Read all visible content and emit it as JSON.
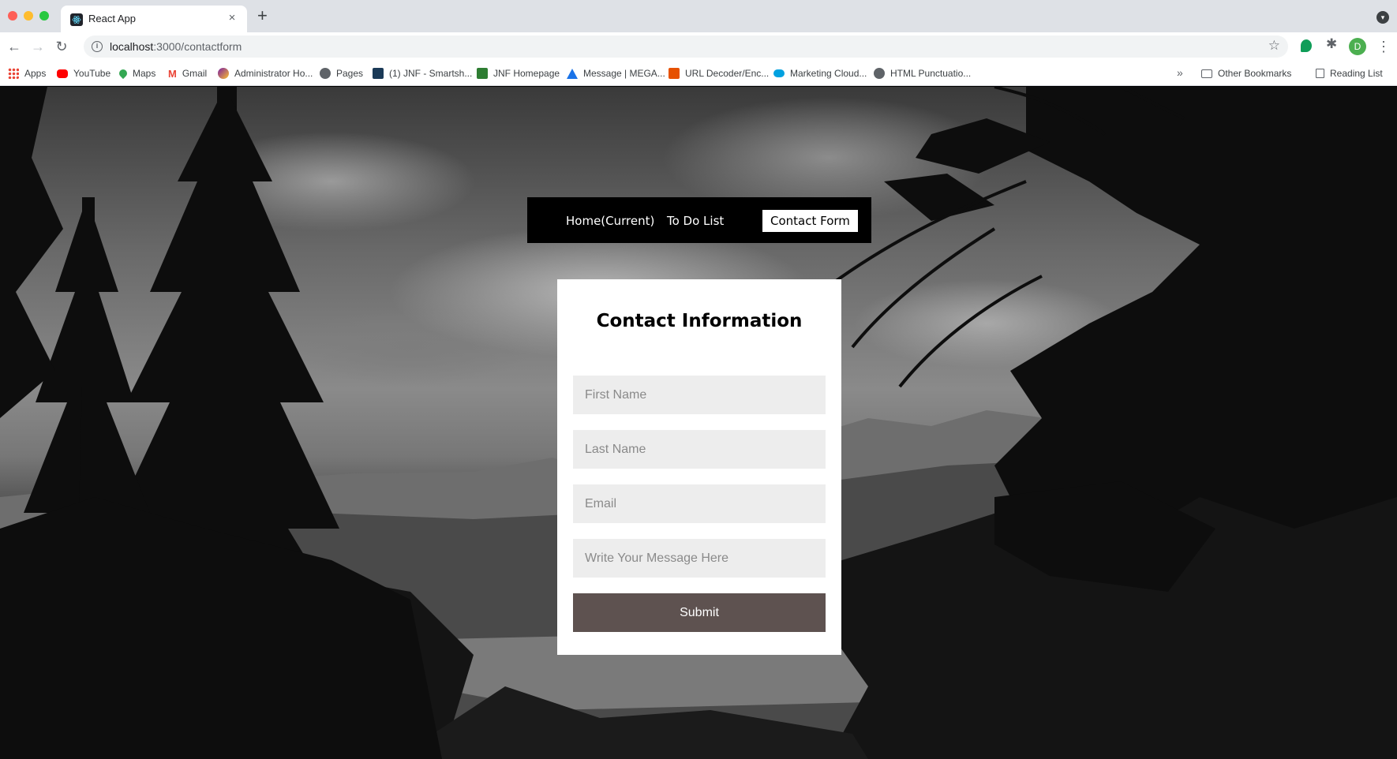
{
  "browser": {
    "tab_title": "React App",
    "tab_close": "×",
    "new_tab": "+",
    "url_host": "localhost",
    "url_path": ":3000/contactform",
    "profile_initial": "D",
    "bookmarks": [
      {
        "label": "Apps",
        "icon": "apps-grid-icon",
        "color": "#ea4335"
      },
      {
        "label": "YouTube",
        "icon": "youtube-icon",
        "color": "#ff0000"
      },
      {
        "label": "Maps",
        "icon": "maps-pin-icon",
        "color": "#34a853"
      },
      {
        "label": "Gmail",
        "icon": "gmail-icon",
        "color": "#ea4335"
      },
      {
        "label": "Administrator Ho...",
        "icon": "admin-icon",
        "color": "#7b1fa2"
      },
      {
        "label": "Pages",
        "icon": "globe-icon",
        "color": "#5f6368"
      },
      {
        "label": "(1) JNF - Smartsh...",
        "icon": "smartsheet-icon",
        "color": "#1b3a57"
      },
      {
        "label": "JNF Homepage",
        "icon": "jnf-icon",
        "color": "#2e7d32"
      },
      {
        "label": "Message | MEGA...",
        "icon": "mega-icon",
        "color": "#1a73e8"
      },
      {
        "label": "URL Decoder/Enc...",
        "icon": "url-decoder-icon",
        "color": "#e65100"
      },
      {
        "label": "Marketing Cloud...",
        "icon": "salesforce-cloud-icon",
        "color": "#00a1e0"
      },
      {
        "label": "HTML Punctuatio...",
        "icon": "globe-icon",
        "color": "#5f6368"
      }
    ],
    "bookmarks_more": "»",
    "other_bookmarks": "Other Bookmarks",
    "reading_list": "Reading List"
  },
  "nav": {
    "items": [
      {
        "label": "Home(Current)",
        "active": false
      },
      {
        "label": "To Do List",
        "active": false
      },
      {
        "label": "Contact Form",
        "active": true
      }
    ]
  },
  "form": {
    "title": "Contact Information",
    "first_name_placeholder": "First Name",
    "last_name_placeholder": "Last Name",
    "email_placeholder": "Email",
    "message_placeholder": "Write Your Message Here",
    "submit_label": "Submit",
    "submit_color": "#5e5250",
    "field_bg": "#ededed"
  }
}
